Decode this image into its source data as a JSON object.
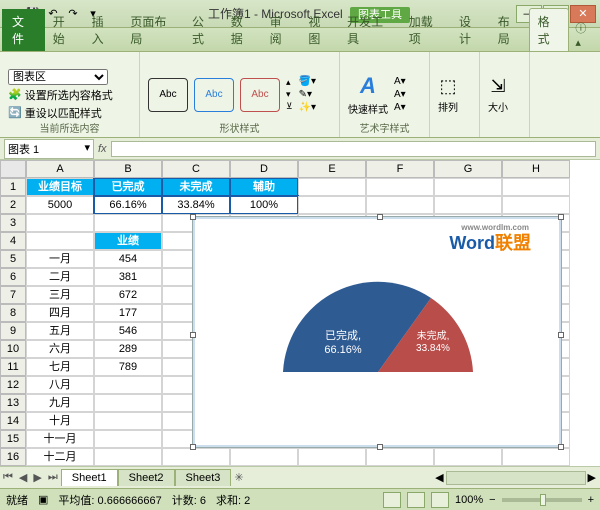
{
  "title": "工作簿1 - Microsoft Excel",
  "context_tab": "图表工具",
  "tabs": [
    "开始",
    "插入",
    "页面布局",
    "公式",
    "数据",
    "审阅",
    "视图",
    "开发工具",
    "加载项",
    "设计",
    "布局",
    "格式"
  ],
  "file_label": "文件",
  "ribbon": {
    "sel_group": "当前所选内容",
    "sel_combo": "图表区",
    "sel_fmt": "设置所选内容格式",
    "sel_reset": "重设以匹配样式",
    "shapes_group": "形状样式",
    "shape_text": "Abc",
    "shape_fill": "形状填充",
    "shape_outline": "形状轮廓",
    "shape_fx": "形状效果",
    "wordart_group": "艺术字样式",
    "quick": "快速样式",
    "arrange": "排列",
    "size": "大小"
  },
  "namebox": "图表 1",
  "fx_label": "fx",
  "cols": [
    "A",
    "B",
    "C",
    "D",
    "E",
    "F",
    "G",
    "H"
  ],
  "rows": {
    "1": [
      "业绩目标",
      "已完成",
      "未完成",
      "辅助",
      "",
      "",
      "",
      ""
    ],
    "2": [
      "5000",
      "66.16%",
      "33.84%",
      "100%",
      "",
      "",
      "",
      ""
    ],
    "3": [
      "",
      "",
      "",
      "",
      "",
      "",
      "",
      ""
    ],
    "4": [
      "",
      "业绩",
      "",
      "",
      "",
      "",
      "",
      ""
    ],
    "5": [
      "一月",
      "454",
      "",
      "",
      "",
      "",
      "",
      ""
    ],
    "6": [
      "二月",
      "381",
      "",
      "",
      "",
      "",
      "",
      ""
    ],
    "7": [
      "三月",
      "672",
      "",
      "",
      "",
      "",
      "",
      ""
    ],
    "8": [
      "四月",
      "177",
      "",
      "",
      "",
      "",
      "",
      ""
    ],
    "9": [
      "五月",
      "546",
      "",
      "",
      "",
      "",
      "",
      ""
    ],
    "10": [
      "六月",
      "289",
      "",
      "",
      "",
      "",
      "",
      ""
    ],
    "11": [
      "七月",
      "789",
      "",
      "",
      "",
      "",
      "",
      ""
    ],
    "12": [
      "八月",
      "",
      "",
      "",
      "",
      "",
      "",
      ""
    ],
    "13": [
      "九月",
      "",
      "",
      "",
      "",
      "",
      "",
      ""
    ],
    "14": [
      "十月",
      "",
      "",
      "",
      "",
      "",
      "",
      ""
    ],
    "15": [
      "十一月",
      "",
      "",
      "",
      "",
      "",
      "",
      ""
    ],
    "16": [
      "十二月",
      "",
      "",
      "",
      "",
      "",
      "",
      ""
    ],
    "17": [
      "",
      "",
      "",
      "",
      "",
      "",
      "",
      ""
    ]
  },
  "chart_data": {
    "type": "pie",
    "title": "",
    "series": [
      {
        "name": "已完成",
        "value": 66.16,
        "label": "已完成,\n66.16%",
        "color": "#2f5b93"
      },
      {
        "name": "未完成",
        "value": 33.84,
        "label": "未完成,\n33.84%",
        "color": "#b84d4a"
      },
      {
        "name": "辅助",
        "value": 100,
        "hidden": true
      }
    ],
    "note": "semicircle gauge: 辅助 slice (100%) forms hidden lower half"
  },
  "watermark": {
    "w1": "Word",
    "w2": "联盟",
    "sub": "www.wordlm.com"
  },
  "sheets": [
    "Sheet1",
    "Sheet2",
    "Sheet3"
  ],
  "status": {
    "ready": "就绪",
    "avg_label": "平均值:",
    "avg": "0.666666667",
    "count_label": "计数:",
    "count": "6",
    "sum_label": "求和:",
    "sum": "2",
    "zoom": "100%"
  }
}
